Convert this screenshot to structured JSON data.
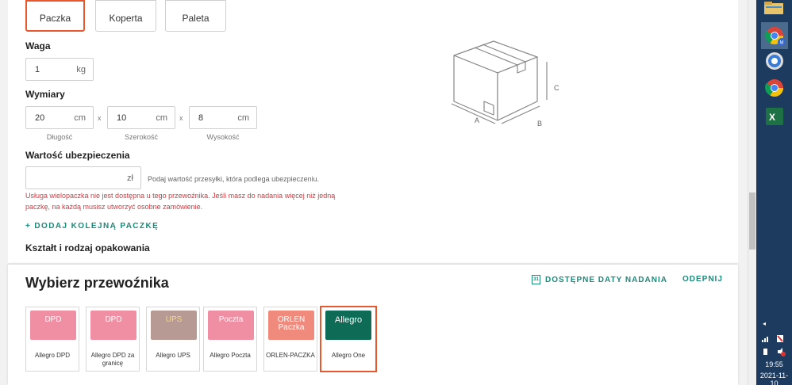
{
  "packages": {
    "options": [
      "Paczka",
      "Koperta",
      "Paleta"
    ]
  },
  "form": {
    "weight_label": "Waga",
    "weight_value": "1",
    "weight_unit": "kg",
    "dimensions_label": "Wymiary",
    "length_value": "20",
    "width_value": "10",
    "height_value": "8",
    "dim_unit": "cm",
    "times": "x",
    "length_label": "Długość",
    "width_label": "Szerokość",
    "height_label": "Wysokość",
    "insurance_label": "Wartość ubezpieczenia",
    "insurance_unit": "zł",
    "insurance_hint": "Podaj wartość przesyłki, która podlega ubezpieczeniu.",
    "error_text": "Usługa wielopaczka nie jest dostępna u tego przewoźnika. Jeśli masz do nadania więcej niż jedną paczkę, na każdą musisz utworzyć osobne zamówienie.",
    "add_package": "+  DODAJ KOLEJNĄ PACZKĘ",
    "shape_label": "Kształt i rodzaj opakowania",
    "diagram_labels": {
      "a": "A",
      "b": "B",
      "c": "C"
    }
  },
  "carriers": {
    "title": "Wybierz przewoźnika",
    "dates_link": "DOSTĘPNE DATY NADANIA",
    "calendar_day": "31",
    "deselect_link": "ODEPNIJ",
    "items": [
      {
        "logo": "DPD",
        "name": "Allegro DPD",
        "color": "#f08fa3",
        "text_color": "#ffffff"
      },
      {
        "logo": "DPD",
        "name": "Allegro DPD za granicę",
        "color": "#f08fa3",
        "text_color": "#ffffff"
      },
      {
        "logo": "UPS",
        "name": "Allegro UPS",
        "color": "#b89a94",
        "text_color": "#f5d98a"
      },
      {
        "logo": "Poczta",
        "name": "Allegro Poczta",
        "color": "#f08fa3",
        "text_color": "#ffffff"
      },
      {
        "logo": "ORLEN Paczka",
        "name": "ORLEN-PACZKA",
        "color": "#ef8a7d",
        "text_color": "#ffffff"
      },
      {
        "logo": "Allegro",
        "name": "Allegro One",
        "color": "#0e6b55",
        "text_color": "#ffffff"
      }
    ]
  },
  "taskbar": {
    "time": "19:55",
    "date": "2021-11-10",
    "icons": [
      "file-explorer-icon",
      "chrome-icon",
      "control-panel-icon",
      "chrome-icon",
      "excel-icon"
    ]
  },
  "colors": {
    "accent": "#e8572e",
    "link": "#1a8a7a",
    "error": "#d8383f"
  }
}
